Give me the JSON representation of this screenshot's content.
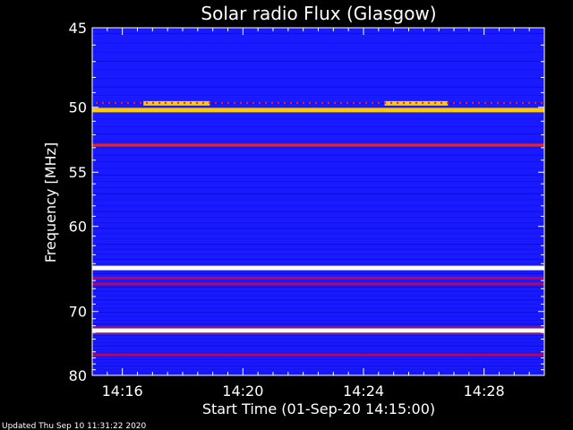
{
  "chart_data": {
    "type": "heatmap",
    "title": "Solar radio Flux (Glasgow)",
    "ylabel": "Frequency [MHz]",
    "xlabel": "Start Time (01-Sep-20 14:15:00)",
    "footer": "Updated Thu Sep 10 11:31:22 2020",
    "x_unit": "minutes after 14:15:00",
    "xlim": [
      0,
      15
    ],
    "ylim_mhz": [
      45,
      80
    ],
    "y_inverted": true,
    "xticks": [
      {
        "value": 1,
        "label": "14:16"
      },
      {
        "value": 5,
        "label": "14:20"
      },
      {
        "value": 9,
        "label": "14:24"
      },
      {
        "value": 13,
        "label": "14:28"
      }
    ],
    "yticks": [
      {
        "value": 45,
        "label": "45"
      },
      {
        "value": 50,
        "label": "50"
      },
      {
        "value": 55,
        "label": "55"
      },
      {
        "value": 60,
        "label": "60"
      },
      {
        "value": 70,
        "label": "70"
      },
      {
        "value": 80,
        "label": "80"
      }
    ],
    "background_color": "#1a1aff",
    "colormap": [
      "#0000c8",
      "#1a1aff",
      "#cc0044",
      "#ff2200",
      "#ffcc00",
      "#ffffee"
    ],
    "features": [
      {
        "type": "band",
        "freq_mhz": 45.1,
        "intensity": 0.25
      },
      {
        "type": "band",
        "freq_mhz": 50.2,
        "intensity": 0.8
      },
      {
        "type": "band",
        "freq_mhz": 52.8,
        "intensity": 0.5
      },
      {
        "type": "band",
        "freq_mhz": 64.5,
        "intensity": 0.9
      },
      {
        "type": "band",
        "freq_mhz": 65.7,
        "intensity": 0.35
      },
      {
        "type": "band",
        "freq_mhz": 66.4,
        "intensity": 0.3
      },
      {
        "type": "band",
        "freq_mhz": 72.7,
        "intensity": 1.0
      },
      {
        "type": "band",
        "freq_mhz": 76.5,
        "intensity": 0.3
      },
      {
        "type": "burst",
        "freq_mhz": 49.7,
        "x_from": 1.7,
        "x_to": 3.9,
        "intensity": 0.85
      },
      {
        "type": "burst",
        "freq_mhz": 49.7,
        "x_from": 9.7,
        "x_to": 11.8,
        "intensity": 0.85
      }
    ]
  }
}
